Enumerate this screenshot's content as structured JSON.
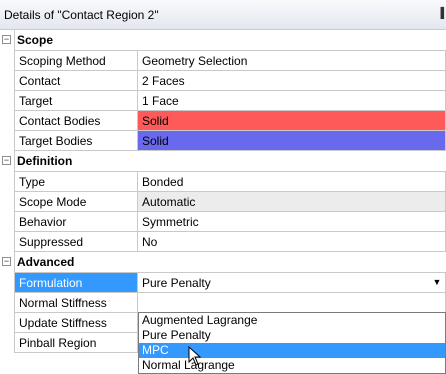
{
  "window": {
    "title": "Details of \"Contact Region 2\""
  },
  "sections": {
    "scope": {
      "label": "Scope",
      "rows": [
        {
          "label": "Scoping Method",
          "value": "Geometry Selection"
        },
        {
          "label": "Contact",
          "value": "2 Faces"
        },
        {
          "label": "Target",
          "value": "1 Face"
        },
        {
          "label": "Contact Bodies",
          "value": "Solid"
        },
        {
          "label": "Target Bodies",
          "value": "Solid"
        }
      ]
    },
    "definition": {
      "label": "Definition",
      "rows": [
        {
          "label": "Type",
          "value": "Bonded"
        },
        {
          "label": "Scope Mode",
          "value": "Automatic"
        },
        {
          "label": "Behavior",
          "value": "Symmetric"
        },
        {
          "label": "Suppressed",
          "value": "No"
        }
      ]
    },
    "advanced": {
      "label": "Advanced",
      "rows": [
        {
          "label": "Formulation",
          "value": "Pure Penalty"
        },
        {
          "label": "Normal Stiffness",
          "value": ""
        },
        {
          "label": "Update Stiffness",
          "value": ""
        },
        {
          "label": "Pinball Region",
          "value": ""
        }
      ]
    }
  },
  "dropdown": {
    "options": [
      "Augmented Lagrange",
      "Pure Penalty",
      "MPC",
      "Normal Lagrange"
    ],
    "highlighted": "MPC"
  },
  "colors": {
    "contact_bodies": "#ff5a5a",
    "target_bodies": "#6969ee",
    "selection": "#3399ff"
  },
  "icons": {
    "collapse": "minus-box-icon",
    "pin": "pin-icon",
    "dropdown": "chevron-down-icon",
    "cursor": "arrow-cursor-icon"
  }
}
